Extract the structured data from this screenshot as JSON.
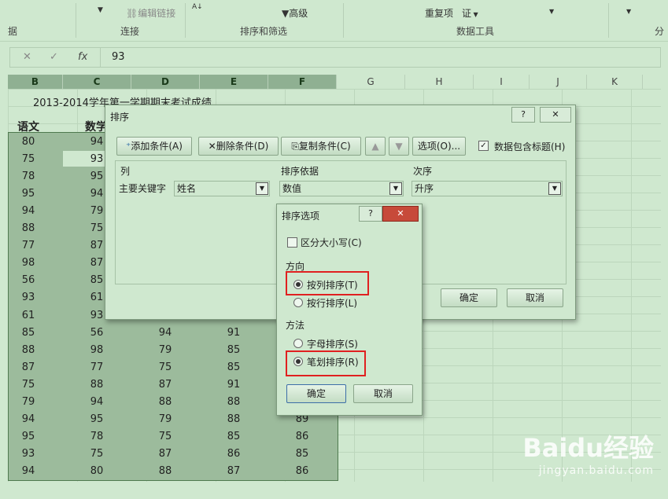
{
  "ribbon": {
    "edit_links": "编辑链接",
    "advanced": "高级",
    "duplicates": "重复项",
    "verify": "证",
    "groups": {
      "data_partial": "据",
      "connections": "连接",
      "sort_filter": "排序和筛选",
      "data_tools": "数据工具",
      "partial_right": "分"
    }
  },
  "formula_bar": {
    "cancel": "✕",
    "enter": "✓",
    "fx": "fx",
    "value": "93"
  },
  "columns": [
    "B",
    "C",
    "D",
    "E",
    "F",
    "G",
    "H",
    "I",
    "J",
    "K"
  ],
  "sheet": {
    "title": "2013-2014学年第一学期期末考试成绩",
    "header_b": "语文",
    "header_c": "数学",
    "col_b": [
      "80",
      "75",
      "78",
      "95",
      "94",
      "88",
      "77",
      "98",
      "56",
      "93",
      "61",
      "85",
      "88",
      "87",
      "75",
      "79",
      "94",
      "95",
      "93",
      "94"
    ],
    "col_c": [
      "94",
      "93",
      "95",
      "94",
      "79",
      "75",
      "87",
      "87",
      "85",
      "61",
      "93",
      "56",
      "98",
      "77",
      "88",
      "94",
      "95",
      "78",
      "75",
      "80"
    ],
    "col_d": [
      "94",
      "79",
      "75",
      "87",
      "88",
      "79",
      "75",
      "87",
      "88"
    ],
    "col_e": [
      "91",
      "85",
      "85",
      "91",
      "88",
      "88",
      "85",
      "86",
      "87"
    ],
    "col_f": [
      "89",
      "86",
      "85",
      "86"
    ]
  },
  "sort_dialog": {
    "title": "排序",
    "help": "?",
    "add_level": "添加条件(A)",
    "delete_level": "删除条件(D)",
    "copy_level": "复制条件(C)",
    "options": "选项(O)...",
    "has_headers": "数据包含标题(H)",
    "col_header": "列",
    "sort_on_header": "排序依据",
    "order_header": "次序",
    "row_label": "主要关键字",
    "column_value": "姓名",
    "sort_on_value": "数值",
    "order_value": "升序",
    "ok": "确定",
    "cancel": "取消"
  },
  "options_dialog": {
    "title": "排序选项",
    "help": "?",
    "case_sensitive": "区分大小写(C)",
    "orientation_label": "方向",
    "sort_top_bottom": "按列排序(T)",
    "sort_left_right": "按行排序(L)",
    "method_label": "方法",
    "letter_sort": "字母排序(S)",
    "stroke_sort": "笔划排序(R)",
    "ok": "确定",
    "cancel": "取消"
  },
  "watermark": {
    "brand": "Baidu经验",
    "url": "jingyan.baidu.com"
  },
  "colors": {
    "sheet_bg": "#cfe8cf",
    "selection": "#9cbb9c",
    "highlight": "#e02020"
  }
}
